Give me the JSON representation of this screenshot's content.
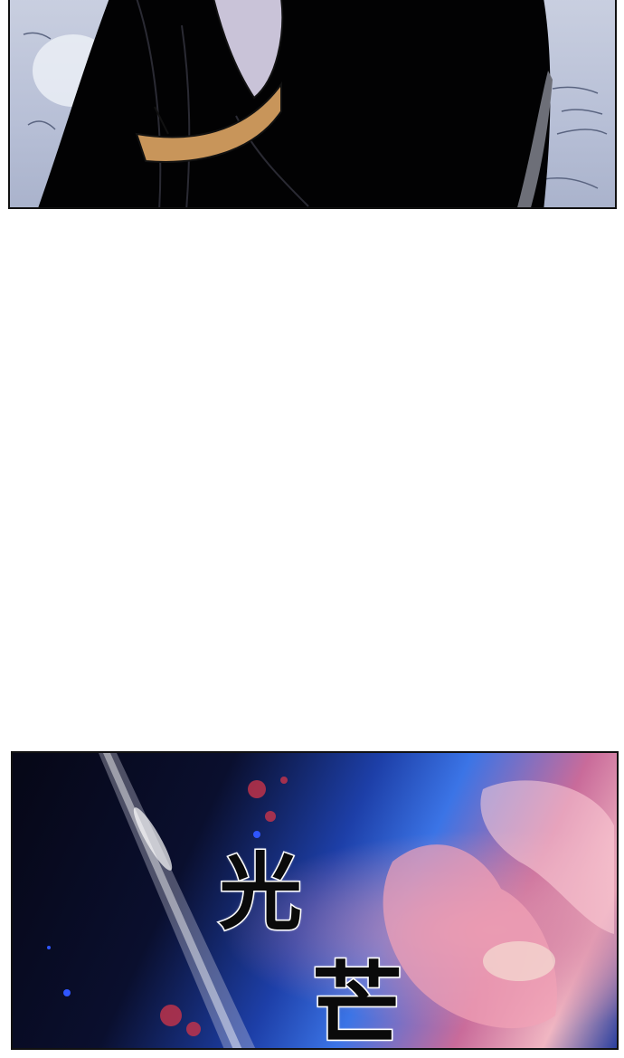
{
  "comic": {
    "sound_effect": {
      "char_1": "光",
      "char_2": "芒"
    }
  },
  "colors": {
    "background": "#ffffff",
    "panel_border": "#111111",
    "sash": "#c8955a",
    "sky_dark": "#060716",
    "sky_blue": "#3b74e6",
    "sky_pink": "#f0b6c2"
  }
}
